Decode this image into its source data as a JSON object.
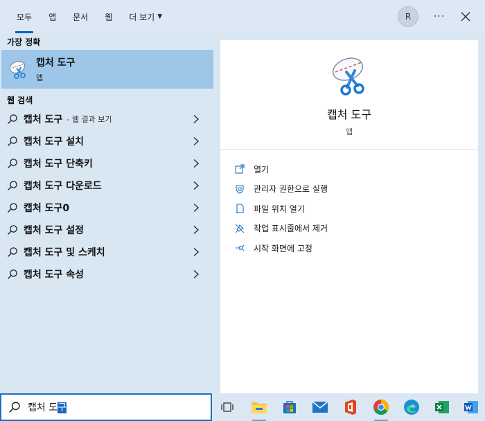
{
  "tabs": [
    {
      "label": "모두",
      "active": true
    },
    {
      "label": "앱"
    },
    {
      "label": "문서"
    },
    {
      "label": "웹"
    },
    {
      "label": "더 보기"
    }
  ],
  "header": {
    "avatar_initial": "R",
    "more_label": "···"
  },
  "best_match": {
    "section_label": "가장 정확",
    "title": "캡처 도구",
    "subtitle": "앱",
    "icon": "snipping-tool-icon"
  },
  "web_search": {
    "section_label": "웹 검색",
    "results": [
      {
        "query": "캡처 도구",
        "suffix": "- 웹 결과 보기"
      },
      {
        "query": "캡처 도구 설치",
        "suffix": ""
      },
      {
        "query": "캡처 도구 단축키",
        "suffix": ""
      },
      {
        "query": "캡처 도구 다운로드",
        "suffix": ""
      },
      {
        "query": "캡처 도구0",
        "suffix": ""
      },
      {
        "query": "캡처 도구 설정",
        "suffix": ""
      },
      {
        "query": "캡처 도구 및 스케치",
        "suffix": ""
      },
      {
        "query": "캡처 도구 속성",
        "suffix": ""
      }
    ]
  },
  "detail": {
    "app_name": "캡처 도구",
    "app_type": "앱",
    "actions": [
      {
        "label": "열기",
        "icon": "open-icon"
      },
      {
        "label": "관리자 권한으로 실행",
        "icon": "shield-icon"
      },
      {
        "label": "파일 위치 열기",
        "icon": "file-location-icon"
      },
      {
        "label": "작업 표시줄에서 제거",
        "icon": "unpin-taskbar-icon"
      },
      {
        "label": "시작 화면에 고정",
        "icon": "pin-start-icon"
      }
    ]
  },
  "search": {
    "typed": "캡처 도",
    "selected": "구"
  },
  "taskbar": {
    "apps": [
      "task-view-icon",
      "file-explorer-icon",
      "microsoft-store-icon",
      "mail-icon",
      "office-icon",
      "chrome-icon",
      "edge-icon",
      "excel-icon",
      "word-icon"
    ]
  },
  "colors": {
    "accent": "#0067c0",
    "selected_bg": "#9dc6e8",
    "panel_bg": "#d9e7f3"
  }
}
